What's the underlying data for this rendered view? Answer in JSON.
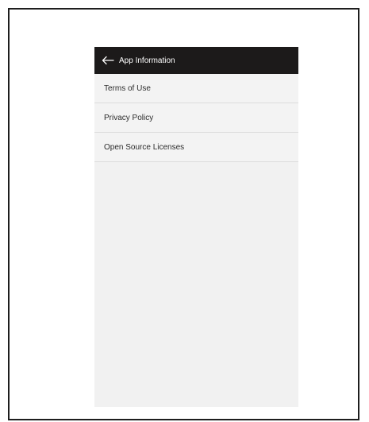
{
  "appbar": {
    "back_icon": "arrow-left-icon",
    "title": "App Information"
  },
  "menu": {
    "items": [
      {
        "label": "Terms of Use"
      },
      {
        "label": "Privacy Policy"
      },
      {
        "label": "Open Source Licenses"
      }
    ]
  },
  "colors": {
    "appbar_bg": "#1c1a1a",
    "screen_bg": "#f1f1f1",
    "divider": "#dcdcdc",
    "frame_border": "#1e1e1e"
  }
}
